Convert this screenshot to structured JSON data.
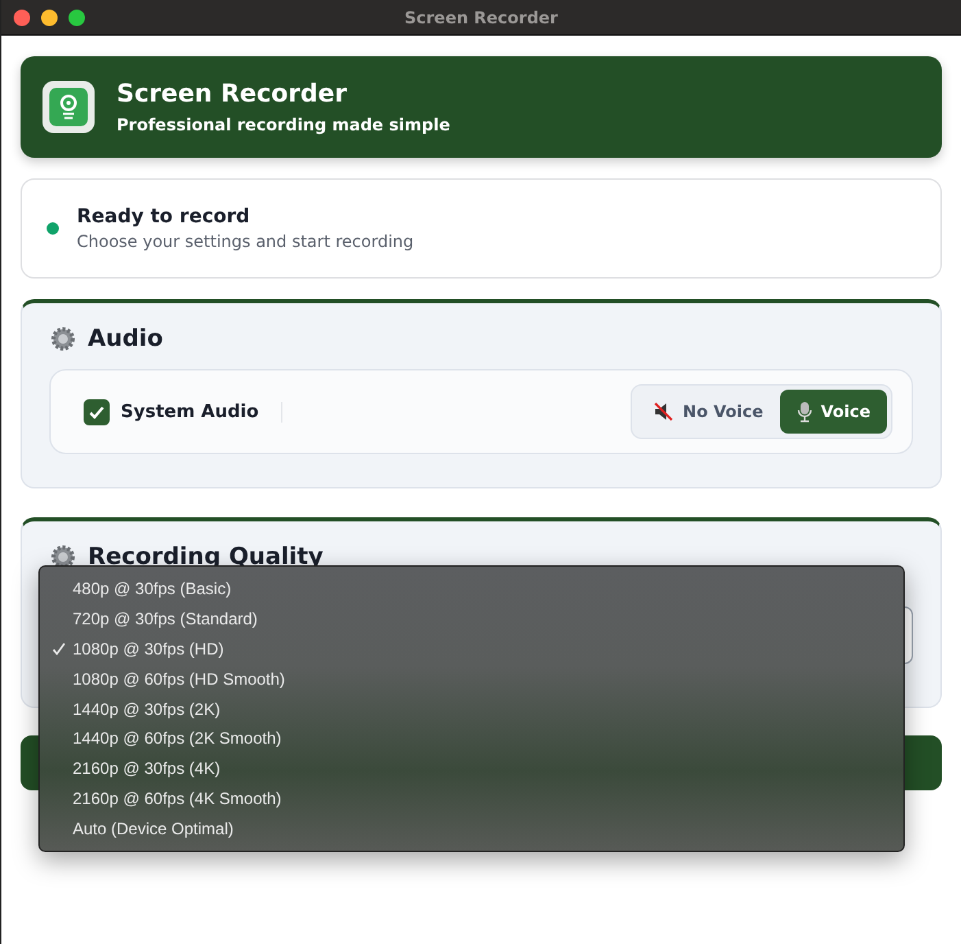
{
  "window": {
    "title": "Screen Recorder"
  },
  "header": {
    "title": "Screen Recorder",
    "subtitle": "Professional recording made simple"
  },
  "status": {
    "title": "Ready to record",
    "message": "Choose your settings and start recording",
    "color": "#10a36a"
  },
  "audio": {
    "title": "Audio",
    "system_audio": {
      "label": "System Audio",
      "checked": true
    },
    "voice_options": [
      {
        "label": "No Voice",
        "kind": "mute",
        "selected": false
      },
      {
        "label": "Voice",
        "kind": "mic",
        "selected": true
      }
    ]
  },
  "quality": {
    "title": "Recording Quality",
    "menu": [
      {
        "label": "480p @ 30fps (Basic)",
        "selected": false
      },
      {
        "label": "720p @ 30fps (Standard)",
        "selected": false
      },
      {
        "label": "1080p @ 30fps (HD)",
        "selected": true
      },
      {
        "label": "1080p @ 60fps (HD Smooth)",
        "selected": false
      },
      {
        "label": "1440p @ 30fps (2K)",
        "selected": false
      },
      {
        "label": "1440p @ 60fps (2K Smooth)",
        "selected": false
      },
      {
        "label": "2160p @ 30fps (4K)",
        "selected": false
      },
      {
        "label": "2160p @ 60fps (4K Smooth)",
        "selected": false
      },
      {
        "label": "Auto (Device Optimal)",
        "selected": false
      }
    ]
  }
}
